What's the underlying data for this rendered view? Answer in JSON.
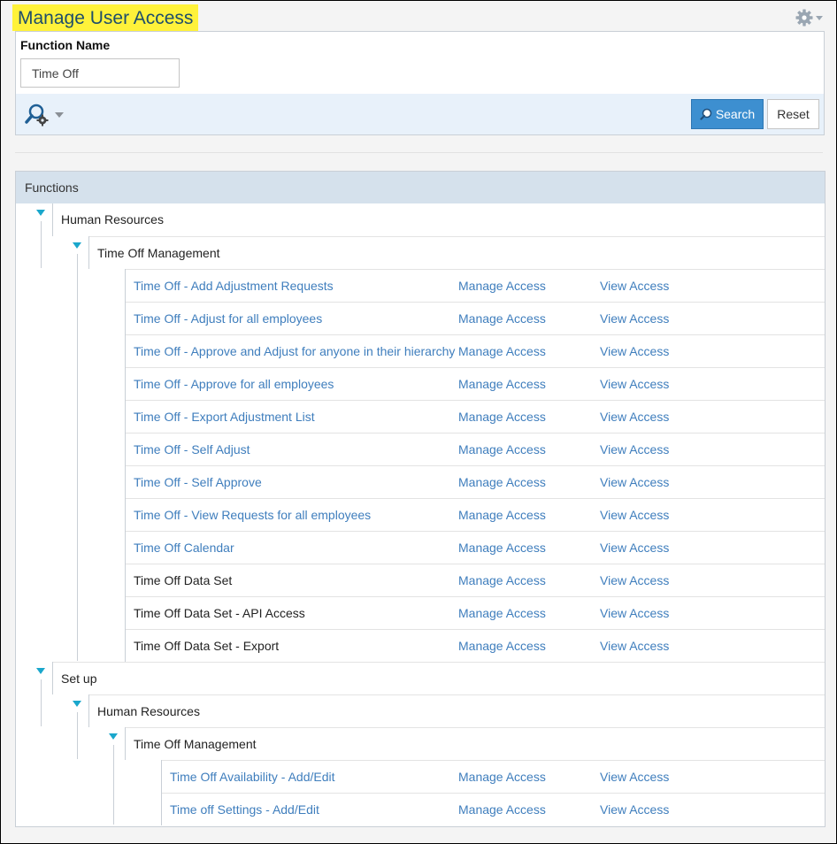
{
  "page": {
    "title": "Manage User Access",
    "settings_icon": "gear-icon"
  },
  "filter": {
    "label": "Function Name",
    "value": "Time Off",
    "search_label": "Search",
    "reset_label": "Reset"
  },
  "functions": {
    "header": "Functions",
    "manage_label": "Manage Access",
    "view_label": "View Access",
    "nodes": [
      {
        "label": "Human Resources",
        "level": 0,
        "type": "group"
      },
      {
        "label": "Time Off Management",
        "level": 1,
        "type": "group"
      },
      {
        "label": "Time Off - Add Adjustment Requests",
        "level": 2,
        "type": "link"
      },
      {
        "label": "Time Off - Adjust for all employees",
        "level": 2,
        "type": "link"
      },
      {
        "label": "Time Off - Approve and Adjust for anyone in their hierarchy",
        "level": 2,
        "type": "link"
      },
      {
        "label": "Time Off - Approve for all employees",
        "level": 2,
        "type": "link"
      },
      {
        "label": "Time Off - Export Adjustment List",
        "level": 2,
        "type": "link"
      },
      {
        "label": "Time Off - Self Adjust",
        "level": 2,
        "type": "link"
      },
      {
        "label": "Time Off - Self Approve",
        "level": 2,
        "type": "link"
      },
      {
        "label": "Time Off - View Requests for all employees",
        "level": 2,
        "type": "link"
      },
      {
        "label": "Time Off Calendar",
        "level": 2,
        "type": "link"
      },
      {
        "label": "Time Off Data Set",
        "level": 2,
        "type": "plain"
      },
      {
        "label": "Time Off Data Set - API Access",
        "level": 2,
        "type": "plain"
      },
      {
        "label": "Time Off Data Set - Export",
        "level": 2,
        "type": "plain"
      },
      {
        "label": "Set up",
        "level": 0,
        "type": "group"
      },
      {
        "label": "Human Resources",
        "level": 1,
        "type": "group"
      },
      {
        "label": "Time Off Management",
        "level": 2,
        "type": "group"
      },
      {
        "label": "Time Off Availability - Add/Edit",
        "level": 3,
        "type": "link"
      },
      {
        "label": "Time off Settings - Add/Edit",
        "level": 3,
        "type": "link"
      }
    ]
  }
}
